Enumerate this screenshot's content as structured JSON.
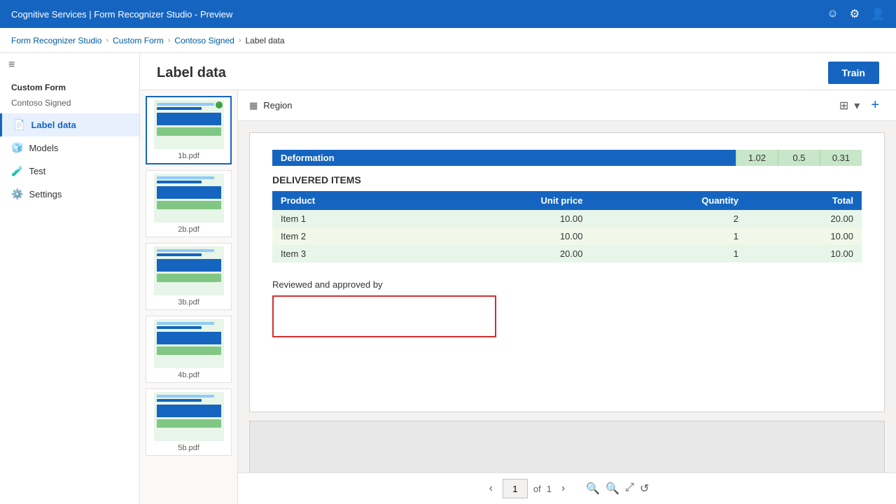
{
  "topbar": {
    "title": "Cognitive Services | Form Recognizer Studio - Preview",
    "icons": [
      "smiley-icon",
      "settings-icon",
      "user-icon"
    ]
  },
  "breadcrumb": {
    "items": [
      "Form Recognizer Studio",
      "Custom Form",
      "Contoso Signed",
      "Label data"
    ]
  },
  "sidebar": {
    "toggle_label": "≡",
    "section_label": "Custom Form",
    "subsection_label": "Contoso Signed",
    "items": [
      {
        "id": "label-data",
        "label": "Label data",
        "icon": "📄",
        "active": true
      },
      {
        "id": "models",
        "label": "Models",
        "icon": "🧊",
        "active": false
      },
      {
        "id": "test",
        "label": "Test",
        "icon": "🧪",
        "active": false
      },
      {
        "id": "settings",
        "label": "Settings",
        "icon": "⚙️",
        "active": false
      }
    ]
  },
  "page_header": {
    "title": "Label data",
    "train_label": "Train"
  },
  "toolbar": {
    "region_label": "Region",
    "add_label": "+"
  },
  "files": [
    {
      "name": "1b.pdf",
      "active": true,
      "has_dot": true
    },
    {
      "name": "2b.pdf",
      "active": false,
      "has_dot": false
    },
    {
      "name": "3b.pdf",
      "active": false,
      "has_dot": false
    },
    {
      "name": "4b.pdf",
      "active": false,
      "has_dot": false
    },
    {
      "name": "5b.pdf",
      "active": false,
      "has_dot": false
    }
  ],
  "document": {
    "deformation": {
      "label": "Deformation",
      "values": [
        "1.02",
        "0.5",
        "0.31"
      ]
    },
    "delivered_items": {
      "section_title": "DELIVERED ITEMS",
      "headers": [
        "Product",
        "Unit price",
        "Quantity",
        "Total"
      ],
      "rows": [
        [
          "Item 1",
          "10.00",
          "2",
          "20.00"
        ],
        [
          "Item 2",
          "10.00",
          "1",
          "10.00"
        ],
        [
          "Item 3",
          "20.00",
          "1",
          "10.00"
        ]
      ]
    },
    "reviewed_label": "Reviewed and approved by",
    "signature_box_placeholder": ""
  },
  "pagination": {
    "current_page": "1",
    "total_pages": "1",
    "of_label": "of"
  }
}
